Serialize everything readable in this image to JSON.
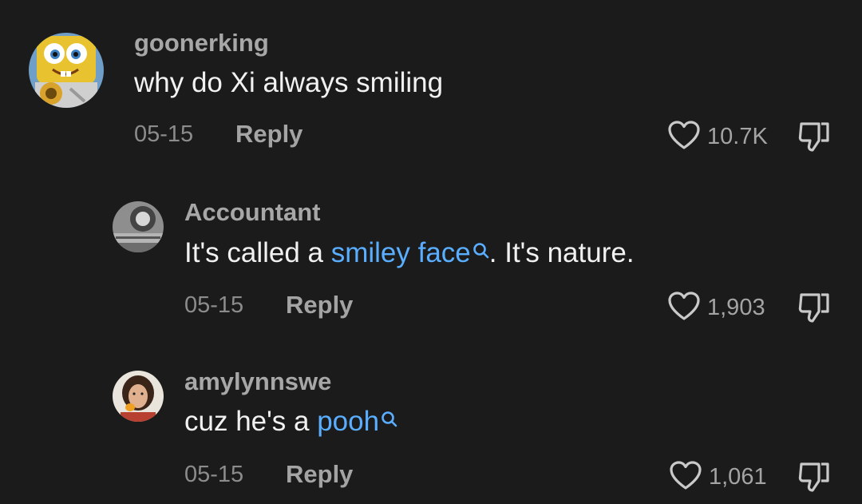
{
  "comments": [
    {
      "username": "goonerking",
      "text": "why do Xi always smiling",
      "date": "05-15",
      "reply_label": "Reply",
      "likes": "10.7K"
    },
    {
      "username": "Accountant",
      "text_before": "It's called a ",
      "link": "smiley face",
      "text_after": ". It's nature.",
      "date": "05-15",
      "reply_label": "Reply",
      "likes": "1,903"
    },
    {
      "username": "amylynnswe",
      "text_before": "cuz he's a ",
      "link": "pooh",
      "date": "05-15",
      "reply_label": "Reply",
      "likes": "1,061"
    }
  ],
  "colors": {
    "background": "#1b1b1b",
    "link": "#5aaeff",
    "muted": "#a4a4a4"
  },
  "icons": [
    "heart-outline-icon",
    "thumbs-down-icon",
    "search-icon"
  ]
}
